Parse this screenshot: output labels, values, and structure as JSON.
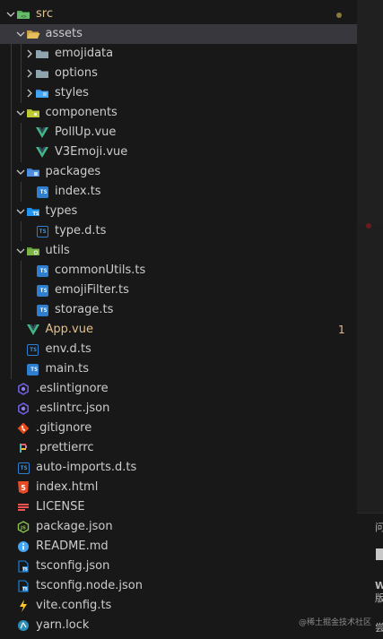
{
  "explorer": {
    "tree": [
      {
        "label": "src",
        "kind": "folder",
        "open": true,
        "depth": 0,
        "icon": "folder-src-icon",
        "color": "#e2c08d",
        "dot": true
      },
      {
        "label": "assets",
        "kind": "folder",
        "open": true,
        "depth": 1,
        "icon": "folder-open-icon",
        "selected": true
      },
      {
        "label": "emojidata",
        "kind": "folder",
        "open": false,
        "depth": 2,
        "icon": "folder-icon"
      },
      {
        "label": "options",
        "kind": "folder",
        "open": false,
        "depth": 2,
        "icon": "folder-icon"
      },
      {
        "label": "styles",
        "kind": "folder",
        "open": false,
        "depth": 2,
        "icon": "folder-styles-icon"
      },
      {
        "label": "components",
        "kind": "folder",
        "open": true,
        "depth": 1,
        "icon": "folder-components-icon"
      },
      {
        "label": "PollUp.vue",
        "kind": "file",
        "depth": 2,
        "icon": "vue-icon"
      },
      {
        "label": "V3Emoji.vue",
        "kind": "file",
        "depth": 2,
        "icon": "vue-icon"
      },
      {
        "label": "packages",
        "kind": "folder",
        "open": true,
        "depth": 1,
        "icon": "folder-packages-icon"
      },
      {
        "label": "index.ts",
        "kind": "file",
        "depth": 2,
        "icon": "typescript-icon"
      },
      {
        "label": "types",
        "kind": "folder",
        "open": true,
        "depth": 1,
        "icon": "folder-types-icon"
      },
      {
        "label": "type.d.ts",
        "kind": "file",
        "depth": 2,
        "icon": "typescript-def-icon"
      },
      {
        "label": "utils",
        "kind": "folder",
        "open": true,
        "depth": 1,
        "icon": "folder-utils-icon"
      },
      {
        "label": "commonUtils.ts",
        "kind": "file",
        "depth": 2,
        "icon": "typescript-icon"
      },
      {
        "label": "emojiFilter.ts",
        "kind": "file",
        "depth": 2,
        "icon": "typescript-icon"
      },
      {
        "label": "storage.ts",
        "kind": "file",
        "depth": 2,
        "icon": "typescript-icon"
      },
      {
        "label": "App.vue",
        "kind": "file",
        "depth": 1,
        "icon": "vue-icon",
        "color": "#e2c08d",
        "badge": "1"
      },
      {
        "label": "env.d.ts",
        "kind": "file",
        "depth": 1,
        "icon": "typescript-def-icon"
      },
      {
        "label": "main.ts",
        "kind": "file",
        "depth": 1,
        "icon": "typescript-icon"
      },
      {
        "label": ".eslintignore",
        "kind": "file",
        "depth": 0,
        "icon": "eslint-icon"
      },
      {
        "label": ".eslintrc.json",
        "kind": "file",
        "depth": 0,
        "icon": "eslint-icon"
      },
      {
        "label": ".gitignore",
        "kind": "file",
        "depth": 0,
        "icon": "git-icon"
      },
      {
        "label": ".prettierrc",
        "kind": "file",
        "depth": 0,
        "icon": "prettier-icon"
      },
      {
        "label": "auto-imports.d.ts",
        "kind": "file",
        "depth": 0,
        "icon": "typescript-def-icon"
      },
      {
        "label": "index.html",
        "kind": "file",
        "depth": 0,
        "icon": "html-icon"
      },
      {
        "label": "LICENSE",
        "kind": "file",
        "depth": 0,
        "icon": "license-icon"
      },
      {
        "label": "package.json",
        "kind": "file",
        "depth": 0,
        "icon": "nodejs-icon"
      },
      {
        "label": "README.md",
        "kind": "file",
        "depth": 0,
        "icon": "info-icon"
      },
      {
        "label": "tsconfig.json",
        "kind": "file",
        "depth": 0,
        "icon": "tsconfig-icon"
      },
      {
        "label": "tsconfig.node.json",
        "kind": "file",
        "depth": 0,
        "icon": "tsconfig-icon"
      },
      {
        "label": "vite.config.ts",
        "kind": "file",
        "depth": 0,
        "icon": "vite-icon"
      },
      {
        "label": "yarn.lock",
        "kind": "file",
        "depth": 0,
        "icon": "yarn-icon"
      }
    ]
  },
  "editor_strip": {
    "glyphs": [
      "问",
      "W",
      "版",
      "尝"
    ],
    "watermark": "@稀土掘金技术社区"
  },
  "colors": {
    "sidebar_bg": "#181818",
    "selected_bg": "#37373d",
    "modified": "#e2c08d",
    "text": "#cccccc",
    "typescript": "#2f7fd1",
    "vue": "#41b883"
  }
}
